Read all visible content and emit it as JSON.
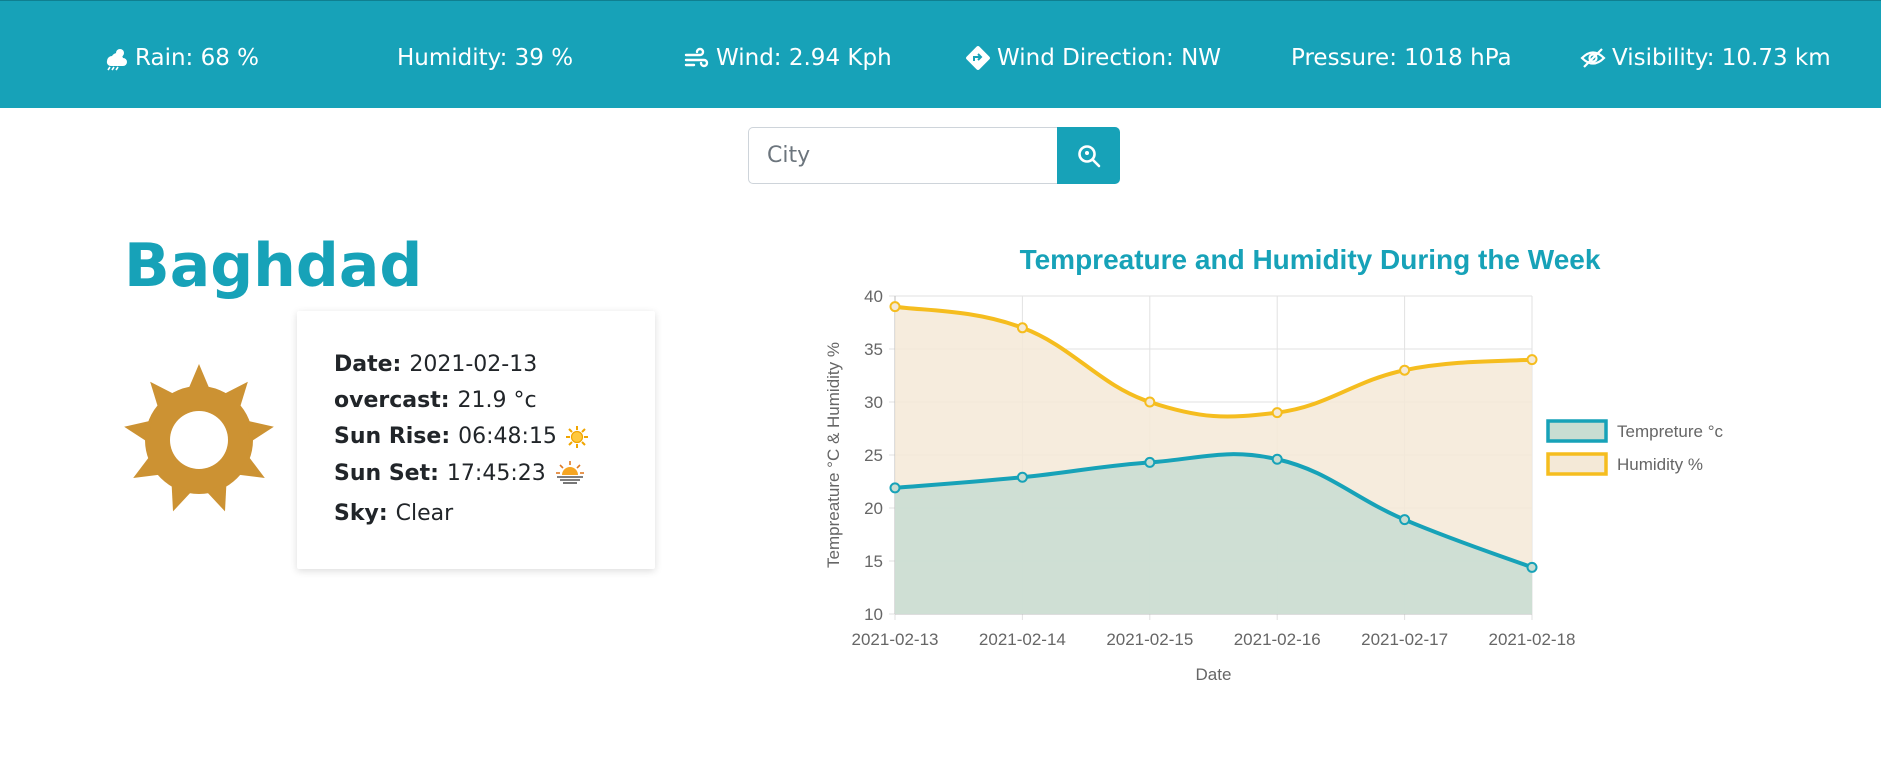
{
  "topbar": {
    "rain": "Rain: 68 %",
    "humidity": "Humidity: 39 %",
    "wind": "Wind: 2.94 Kph",
    "wind_direction": "Wind Direction: NW",
    "pressure": "Pressure: 1018 hPa",
    "visibility": "Visibility: 10.73 km"
  },
  "search": {
    "placeholder": "City"
  },
  "city": "Baghdad",
  "card": {
    "date_label": "Date:",
    "date_value": "2021-02-13",
    "overcast_label": "overcast:",
    "overcast_value": "21.9 °c",
    "sunrise_label": "Sun Rise:",
    "sunrise_value": "06:48:15",
    "sunset_label": "Sun Set:",
    "sunset_value": "17:45:23",
    "sky_label": "Sky:",
    "sky_value": "Clear"
  },
  "colors": {
    "accent": "#17a2b8",
    "sun": "#cc9233",
    "humidity_line": "#f5bd1f"
  },
  "chart_data": {
    "type": "line",
    "title": "Tempreature and Humidity During the Week",
    "xlabel": "Date",
    "ylabel": "Tempreature °C & Humidity %",
    "categories": [
      "2021-02-13",
      "2021-02-14",
      "2021-02-15",
      "2021-02-16",
      "2021-02-17",
      "2021-02-18"
    ],
    "ylim": [
      10,
      40
    ],
    "yticks": [
      10,
      15,
      20,
      25,
      30,
      35,
      40
    ],
    "grid": true,
    "legend_position": "right",
    "series": [
      {
        "name": "Tempreture °c",
        "values": [
          21.9,
          22.9,
          24.3,
          24.6,
          18.9,
          14.4
        ],
        "color": "#17a2b8",
        "fill": "#c8ddd2"
      },
      {
        "name": "Humidity %",
        "values": [
          39,
          37,
          30,
          29,
          33,
          34
        ],
        "color": "#f5bd1f",
        "fill": "#f4e9d7"
      }
    ]
  }
}
